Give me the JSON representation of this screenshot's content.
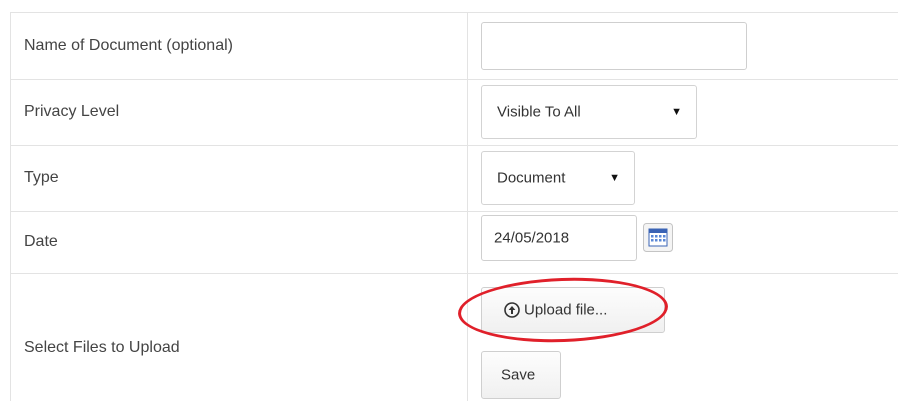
{
  "form": {
    "rows": [
      {
        "label": "Name of Document (optional)",
        "value": ""
      },
      {
        "label": "Privacy Level",
        "value": "Visible To All"
      },
      {
        "label": "Type",
        "value": "Document"
      },
      {
        "label": "Date",
        "value": "24/05/2018"
      },
      {
        "label": "Select Files to Upload"
      }
    ],
    "upload_label": "Upload file...",
    "save_label": "Save"
  },
  "icons": {
    "dropdown": "caret-down-icon",
    "calendar": "calendar-icon",
    "upload": "upload-circle-icon"
  },
  "colors": {
    "annotation": "#e0202a",
    "border": "#e3e3e3"
  }
}
